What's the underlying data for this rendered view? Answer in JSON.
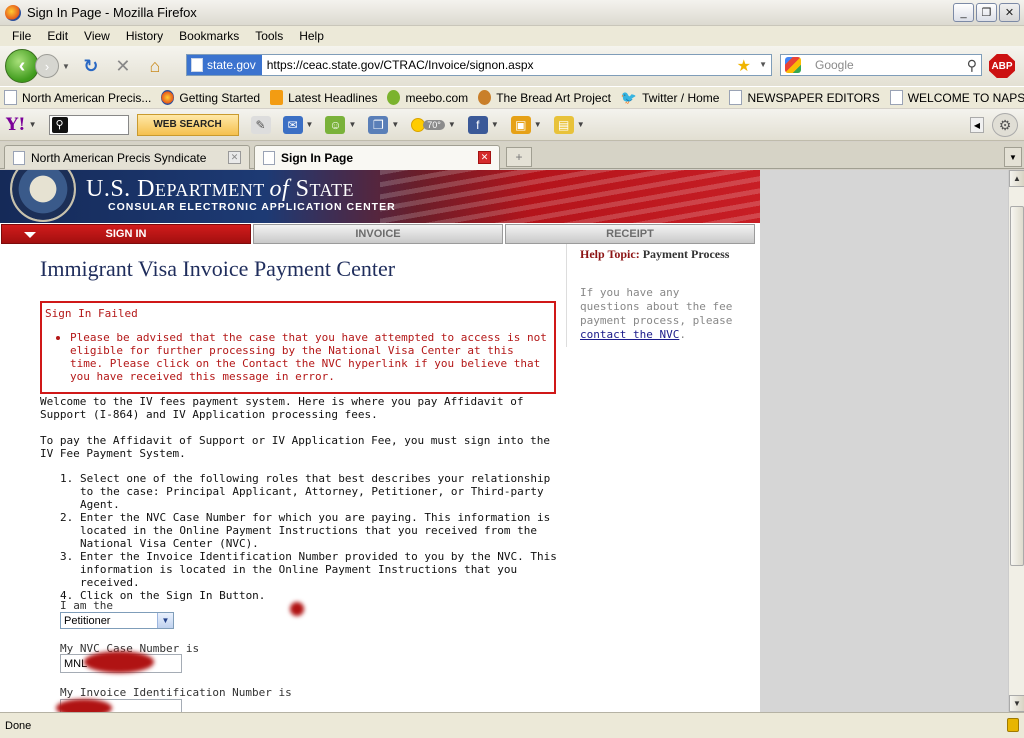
{
  "window": {
    "title": "Sign In Page - Mozilla Firefox",
    "buttons": [
      "_",
      "❐",
      "✕"
    ]
  },
  "menu": [
    "File",
    "Edit",
    "View",
    "History",
    "Bookmarks",
    "Tools",
    "Help"
  ],
  "nav": {
    "site_identity": "state.gov",
    "url": "https://ceac.state.gov/CTRAC/Invoice/signon.aspx",
    "search_placeholder": "Google"
  },
  "bookmarks": [
    {
      "label": "North American Precis...",
      "icon": "page-icon"
    },
    {
      "label": "Getting Started",
      "icon": "firefox-icon"
    },
    {
      "label": "Latest Headlines",
      "icon": "rss-icon"
    },
    {
      "label": "meebo.com",
      "icon": "meebo-icon"
    },
    {
      "label": "The Bread Art Project",
      "icon": "bread-icon"
    },
    {
      "label": "Twitter / Home",
      "icon": "twitter-icon"
    },
    {
      "label": "NEWSPAPER EDITORS",
      "icon": "page-icon"
    },
    {
      "label": "WELCOME TO NAPS",
      "icon": "page-icon"
    }
  ],
  "yahoo_toolbar": {
    "logo": "Y!",
    "web_search_label": "WEB SEARCH",
    "temperature": "70°"
  },
  "tabs": [
    {
      "label": "North American Precis Syndicate",
      "active": false
    },
    {
      "label": "Sign In Page",
      "active": true
    }
  ],
  "page": {
    "banner_title_a": "U.S. D",
    "banner_title_b": "EPARTMENT ",
    "banner_title_of": "of",
    "banner_title_c": " S",
    "banner_title_d": "TATE",
    "banner_subtitle": "CONSULAR ELECTRONIC APPLICATION CENTER",
    "nav_tabs": {
      "signin": "SIGN IN",
      "invoice": "INVOICE",
      "receipt": "RECEIPT"
    },
    "heading": "Immigrant Visa Invoice Payment Center",
    "error": {
      "title": "Sign In Failed",
      "message": "Please be advised that the case that you have attempted to access is not eligible for further processing by the National Visa Center at this time. Please click on the Contact the NVC hyperlink if you believe that you have received this message in error."
    },
    "welcome": "Welcome to the IV fees payment system. Here is where you pay Affidavit of Support (I-864) and IV Application processing fees.",
    "to_pay": "To pay the Affidavit of Support or IV Application Fee, you must sign into the IV Fee Payment System.",
    "steps": [
      {
        "num": "1.",
        "text": "Select one of the following roles that best describes your relationship to the case: Principal Applicant, Attorney, Petitioner, or Third-party Agent."
      },
      {
        "num": "2.",
        "text": "Enter the NVC Case Number for which you are paying. This information is located in the Online Payment Instructions that you received from the National Visa Center (NVC)."
      },
      {
        "num": "3.",
        "text": "Enter the Invoice Identification Number provided to you by the NVC. This information is located in the Online Payment Instructions that you received."
      },
      {
        "num": "4.",
        "text": "Click on the Sign In Button."
      }
    ],
    "form": {
      "role_label": "I am the",
      "role_value": "Petitioner",
      "case_label": "My NVC Case Number is",
      "case_value": "MNL",
      "invoice_label": "My Invoice Identification Number is",
      "invoice_value": ""
    },
    "sidebar": {
      "help_label": "Help Topic:",
      "help_value": "Payment Process",
      "text": "If you have any questions about the fee payment process, please ",
      "link": "contact the NVC",
      "end": "."
    }
  },
  "status": {
    "text": "Done"
  }
}
